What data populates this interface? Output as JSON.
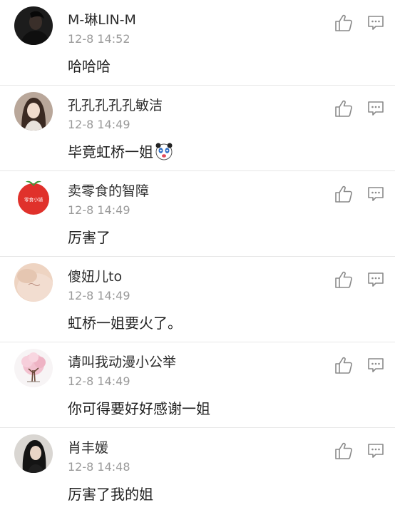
{
  "comments": [
    {
      "username": "M-琳LIN-M",
      "time": "12-8 14:52",
      "text": "哈哈哈",
      "avatar_icon": "dark-portrait-avatar"
    },
    {
      "username": "孔孔孔孔孔敏洁",
      "time": "12-8 14:49",
      "text": "毕竟虹桥一姐",
      "emoji_icon": "panda-face-emoji",
      "avatar_icon": "portrait-avatar"
    },
    {
      "username": "卖零食的智障",
      "time": "12-8 14:49",
      "text": "厉害了",
      "avatar_icon": "red-apple-logo-avatar",
      "avatar_text": "零食小铺"
    },
    {
      "username": "傻妞儿to",
      "time": "12-8 14:49",
      "text": "虹桥一姐要火了。",
      "avatar_icon": "skin-closeup-avatar"
    },
    {
      "username": "请叫我动漫小公举",
      "time": "12-8 14:49",
      "text": "你可得要好好感谢一姐",
      "avatar_icon": "pink-tree-avatar"
    },
    {
      "username": "肖丰媛",
      "time": "12-8 14:48",
      "text": "厉害了我的姐",
      "avatar_icon": "dark-hair-portrait-avatar"
    }
  ],
  "actions": {
    "like_icon": "thumbs-up-icon",
    "reply_icon": "comment-bubble-icon",
    "icon_color": "#8a8a8a"
  }
}
